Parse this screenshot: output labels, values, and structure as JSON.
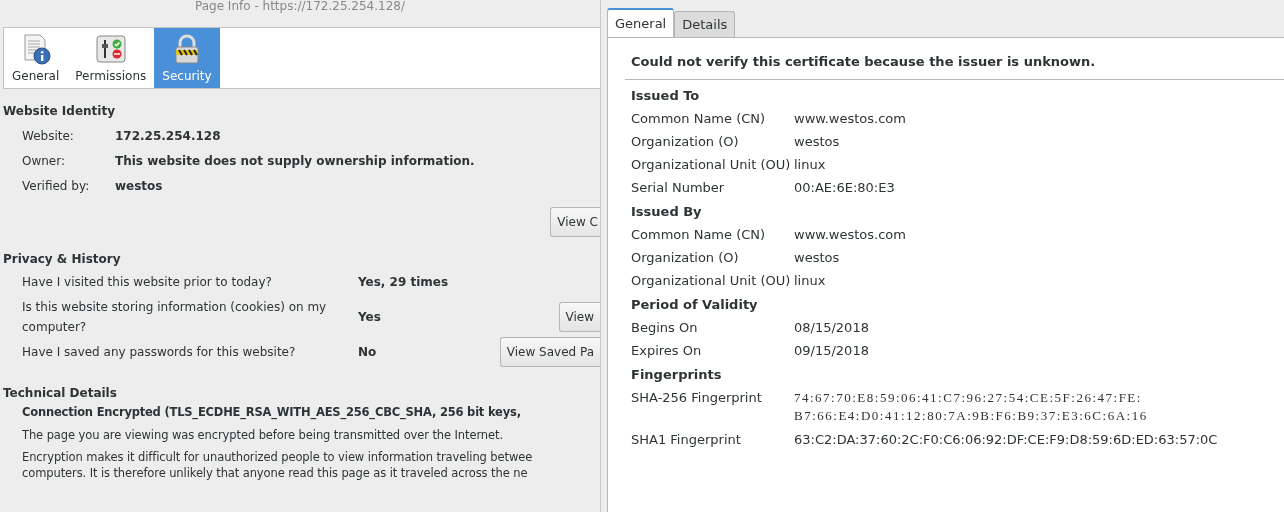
{
  "window": {
    "title": "Page Info - https://172.25.254.128/"
  },
  "toolbar": [
    {
      "label": "General",
      "selected": false
    },
    {
      "label": "Permissions",
      "selected": false
    },
    {
      "label": "Security",
      "selected": true
    }
  ],
  "identity": {
    "heading": "Website Identity",
    "rows": [
      {
        "label": "Website:",
        "value": "172.25.254.128"
      },
      {
        "label": "Owner:",
        "value": "This website does not supply ownership information."
      },
      {
        "label": "Verified by:",
        "value": "westos"
      }
    ],
    "button": "View C"
  },
  "privacy": {
    "heading": "Privacy & History",
    "rows": [
      {
        "question": "Have I visited this website prior to today?",
        "answer": "Yes, 29 times"
      },
      {
        "question": "Is this website storing information (cookies) on my computer?",
        "answer": "Yes",
        "button": "View"
      },
      {
        "question": "Have I saved any passwords for this website?",
        "answer": "No",
        "button": "View Saved Pa"
      }
    ]
  },
  "technical": {
    "heading": "Technical Details",
    "connection": "Connection Encrypted (TLS_ECDHE_RSA_WITH_AES_256_CBC_SHA, 256 bit keys,",
    "paragraphs": [
      "The page you are viewing was encrypted before being transmitted over the Internet.",
      "Encryption makes it difficult for unauthorized people to view information traveling betwee",
      "computers. It is therefore unlikely that anyone read this page as it traveled across the ne"
    ]
  },
  "certificate": {
    "tabs": [
      {
        "label": "General",
        "selected": true
      },
      {
        "label": "Details",
        "selected": false
      }
    ],
    "warning": "Could not verify this certificate because the issuer is unknown.",
    "sections": [
      {
        "heading": "Issued To",
        "rows": [
          {
            "label": "Common Name (CN)",
            "value": [
              "www.westos.com"
            ]
          },
          {
            "label": "Organization (O)",
            "value": [
              "westos"
            ]
          },
          {
            "label": "Organizational Unit (OU)",
            "value": [
              "linux"
            ]
          },
          {
            "label": "Serial Number",
            "value": [
              "00:AE:6E:80:E3"
            ]
          }
        ]
      },
      {
        "heading": "Issued By",
        "rows": [
          {
            "label": "Common Name (CN)",
            "value": [
              "www.westos.com"
            ]
          },
          {
            "label": "Organization (O)",
            "value": [
              "westos"
            ]
          },
          {
            "label": "Organizational Unit (OU)",
            "value": [
              "linux"
            ]
          }
        ]
      },
      {
        "heading": "Period of Validity",
        "rows": [
          {
            "label": "Begins On",
            "value": [
              "08/15/2018"
            ]
          },
          {
            "label": "Expires On",
            "value": [
              "09/15/2018"
            ]
          }
        ]
      },
      {
        "heading": "Fingerprints",
        "rows": [
          {
            "label": "SHA-256 Fingerprint",
            "kind": "mono",
            "value": [
              "74:67:70:E8:59:06:41:C7:96:27:54:CE:5F:26:47:FE:",
              "B7:66:E4:D0:41:12:80:7A:9B:F6:B9:37:E3:6C:6A:16"
            ]
          },
          {
            "label": "SHA1 Fingerprint",
            "value": [
              "63:C2:DA:37:60:2C:F0:C6:06:92:DF:CE:F9:D8:59:6D:ED:63:57:0C"
            ]
          }
        ]
      }
    ]
  }
}
